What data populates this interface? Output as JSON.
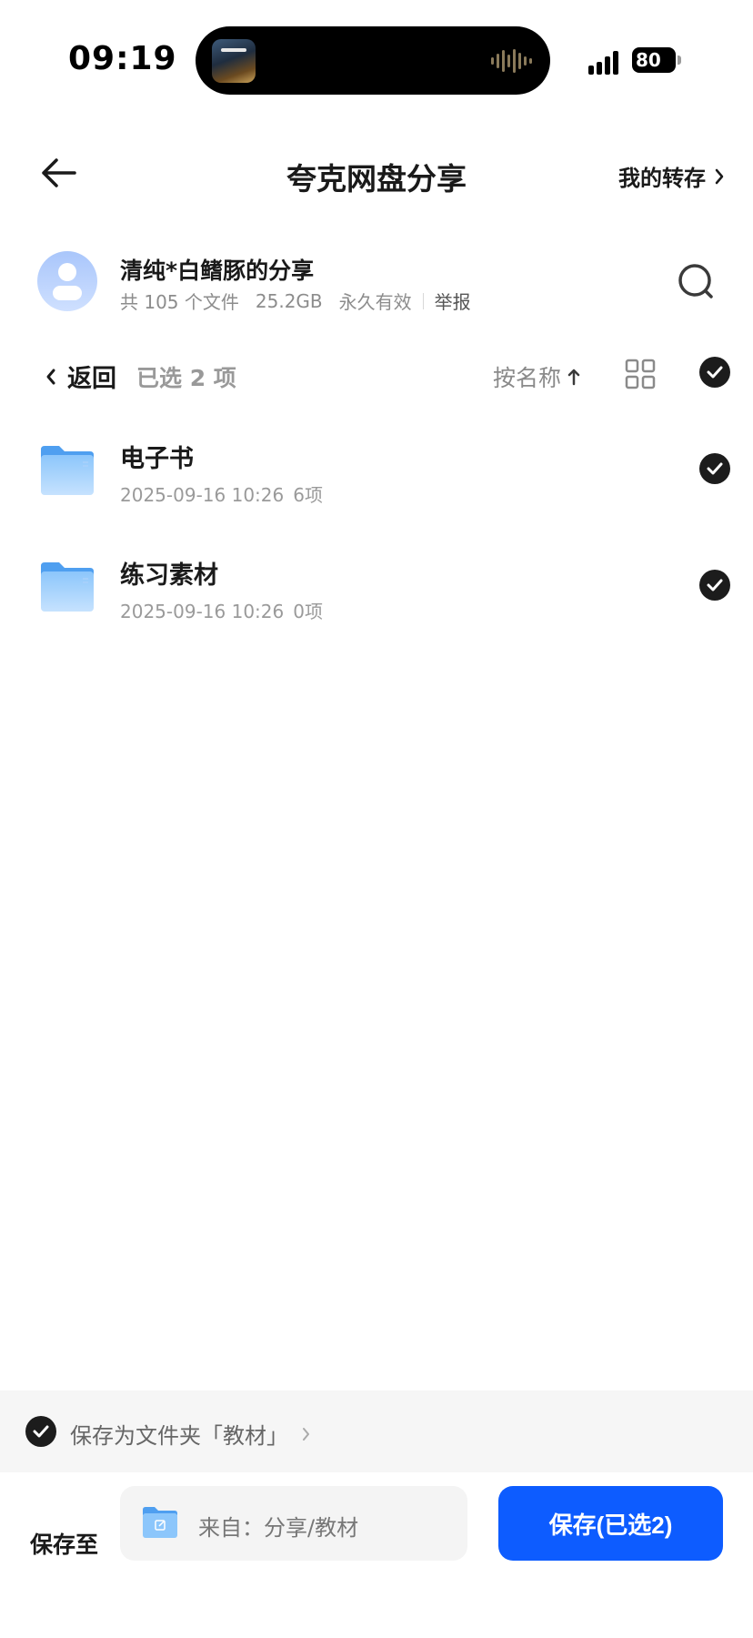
{
  "status_bar": {
    "time": "09:19",
    "battery_level": "80",
    "battery_icon": "battery-charging-icon",
    "signal_icon": "cellular-signal-icon"
  },
  "header": {
    "title": "夸克网盘分享",
    "my_saves_label": "我的转存",
    "back_icon": "arrow-left-icon"
  },
  "sharer": {
    "name": "清纯*白鳍豚的分享",
    "file_count_text": "共 105 个文件",
    "total_size": "25.2GB",
    "validity": "永久有效",
    "report_label": "举报"
  },
  "toolbar": {
    "back_label": "返回",
    "selected_text": "已选 2 项",
    "sort_label": "按名称",
    "sort_direction_icon": "arrow-up-icon"
  },
  "files": [
    {
      "name": "电子书",
      "date": "2025-09-16 10:26",
      "count": "6项",
      "selected": true
    },
    {
      "name": "练习素材",
      "date": "2025-09-16 10:26",
      "count": "0项",
      "selected": true
    }
  ],
  "save_option": {
    "label": "保存为文件夹「教材」",
    "checked": true
  },
  "save_bar": {
    "save_to_label": "保存至",
    "destination": "来自：分享/教材",
    "save_button_label": "保存(已选2)"
  },
  "colors": {
    "accent": "#0d5cff",
    "check_fill": "#1c1c1c",
    "folder_blue": "#6fb3f5"
  }
}
